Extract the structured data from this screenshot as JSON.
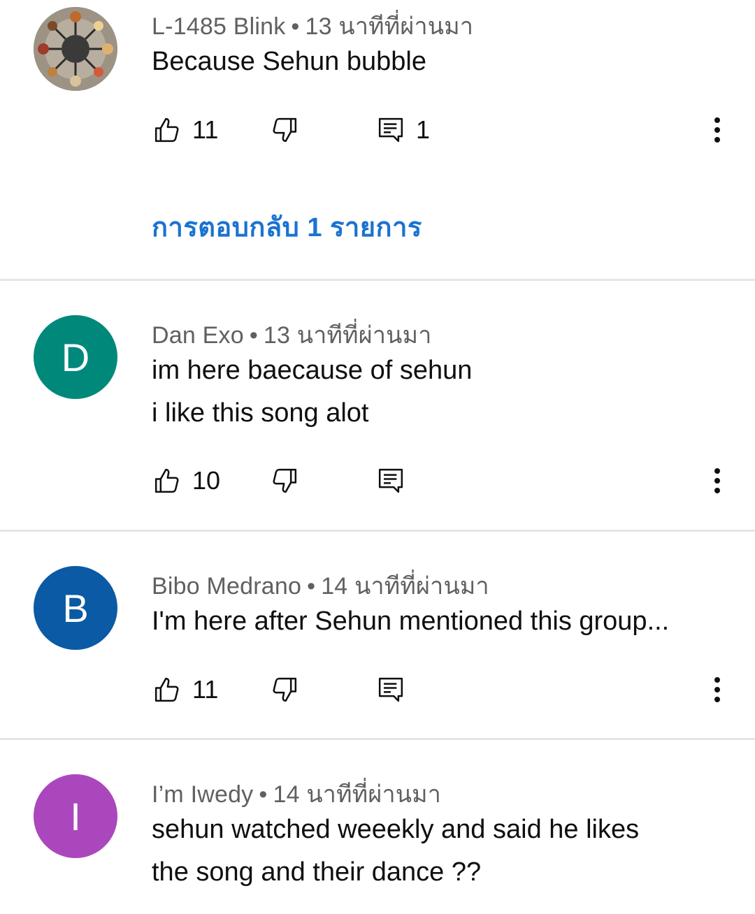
{
  "comments": [
    {
      "author": "L-1485 Blink",
      "separator": "•",
      "time": "13 นาทีที่ผ่านมา",
      "lines": [
        "Because Sehun bubble"
      ],
      "avatar": {
        "type": "guitar-collage-image"
      },
      "likes": "11",
      "replies_count": "1",
      "replies_link": "การตอบกลับ 1 รายการ"
    },
    {
      "author": "Dan Exo",
      "separator": "•",
      "time": "13 นาทีที่ผ่านมา",
      "lines": [
        "im here baecause of sehun",
        "i like this song alot"
      ],
      "avatar": {
        "letter": "D",
        "color": "#00897b"
      },
      "likes": "10"
    },
    {
      "author": "Bibo Medrano",
      "separator": "•",
      "time": "14 นาทีที่ผ่านมา",
      "lines": [
        "I'm here after Sehun mentioned this group..."
      ],
      "avatar": {
        "letter": "B",
        "color": "#0b5aa5"
      },
      "likes": "11"
    },
    {
      "author": "I’m Iwedy",
      "separator": "•",
      "time": "14 นาทีที่ผ่านมา",
      "lines": [
        "sehun watched weeekly and said he likes",
        "the song and their dance ??"
      ],
      "avatar": {
        "letter": "I",
        "color": "#ab47bc"
      }
    }
  ],
  "colors": {
    "link_blue": "#1a73d0",
    "meta_gray": "#606060",
    "divider": "#e5e5e5"
  },
  "icons": [
    "thumb-up-icon",
    "thumb-down-icon",
    "reply-comment-icon",
    "more-vert-icon"
  ]
}
